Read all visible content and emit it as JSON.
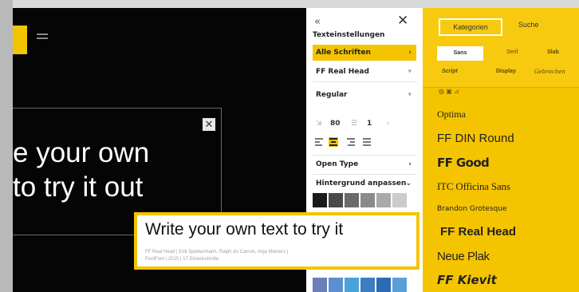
{
  "settings": {
    "back_icon": "«",
    "close_icon": "✕",
    "title": "Texteinstellungen",
    "all_fonts": "Alle Schriften",
    "font_name": "FF Real Head",
    "weight": "Regular",
    "size_value": "80",
    "line_value": "1",
    "open_type": "Open Type",
    "background": "Hintergrund anpassen"
  },
  "sample": {
    "line1": "e your own",
    "line2": "to try it out"
  },
  "tooltip": {
    "text": "Write your own text to try it",
    "meta_line1": "FF Real Head | Erik Spiekermann, Ralph du Carrois, Anja Meiners |",
    "meta_line2": "FontFont | 2015 | 17 Einzelschnitte"
  },
  "fonts_panel": {
    "tab_categories": "Kategorien",
    "tab_search": "Suche",
    "categories": [
      "Sans",
      "Serif",
      "Slab",
      "Script",
      "Display",
      "Gebrochen"
    ],
    "items": [
      "Optima",
      "FF DIN Round",
      "FF Good",
      "ITC Officina Sans",
      "Brandon Grotesque",
      "FF Real Head",
      "Neue Plak",
      "FF Kievit"
    ]
  },
  "colors": {
    "accent": "#f5c400",
    "background": "#050505",
    "panel": "#ffffff"
  }
}
